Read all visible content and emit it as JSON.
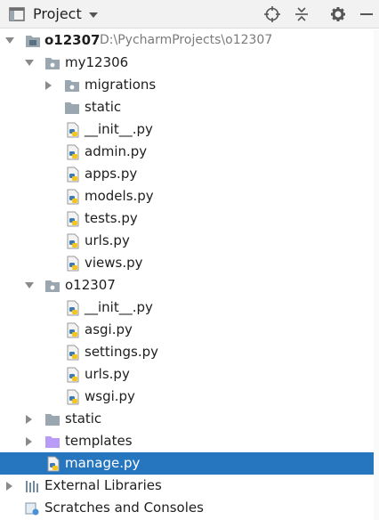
{
  "header": {
    "title": "Project",
    "icons": [
      "project-window-icon",
      "locate-icon",
      "collapse-all-icon",
      "settings-gear-icon",
      "minimize-icon"
    ]
  },
  "tree": [
    {
      "label": "o12307",
      "path": "D:\\PycharmProjects\\o12307",
      "icon": "project-folder-icon",
      "expanded": true
    },
    {
      "label": "my12306",
      "icon": "package-folder-icon",
      "expanded": true
    },
    {
      "label": "migrations",
      "icon": "package-folder-icon",
      "expanded": false
    },
    {
      "label": "static",
      "icon": "folder-icon"
    },
    {
      "label": "__init__.py",
      "icon": "python-file-icon"
    },
    {
      "label": "admin.py",
      "icon": "python-file-icon"
    },
    {
      "label": "apps.py",
      "icon": "python-file-icon"
    },
    {
      "label": "models.py",
      "icon": "python-file-icon"
    },
    {
      "label": "tests.py",
      "icon": "python-file-icon"
    },
    {
      "label": "urls.py",
      "icon": "python-file-icon"
    },
    {
      "label": "views.py",
      "icon": "python-file-icon"
    },
    {
      "label": "o12307",
      "icon": "package-folder-icon",
      "expanded": true
    },
    {
      "label": "__init__.py",
      "icon": "python-file-icon"
    },
    {
      "label": "asgi.py",
      "icon": "python-file-icon"
    },
    {
      "label": "settings.py",
      "icon": "python-file-icon"
    },
    {
      "label": "urls.py",
      "icon": "python-file-icon"
    },
    {
      "label": "wsgi.py",
      "icon": "python-file-icon"
    },
    {
      "label": "static",
      "icon": "folder-icon",
      "expanded": false
    },
    {
      "label": "templates",
      "icon": "templates-folder-icon",
      "expanded": false
    },
    {
      "label": "manage.py",
      "icon": "python-file-icon",
      "selected": true
    },
    {
      "label": "External Libraries",
      "icon": "libraries-icon",
      "expanded": false
    },
    {
      "label": "Scratches and Consoles",
      "icon": "scratches-icon",
      "expanded": false
    }
  ],
  "colors": {
    "selection": "#2675bf",
    "folder": "#9aa7b0",
    "templates_folder": "#b99bf8",
    "python_blue": "#3d7ab3",
    "python_yellow": "#f5c518"
  }
}
